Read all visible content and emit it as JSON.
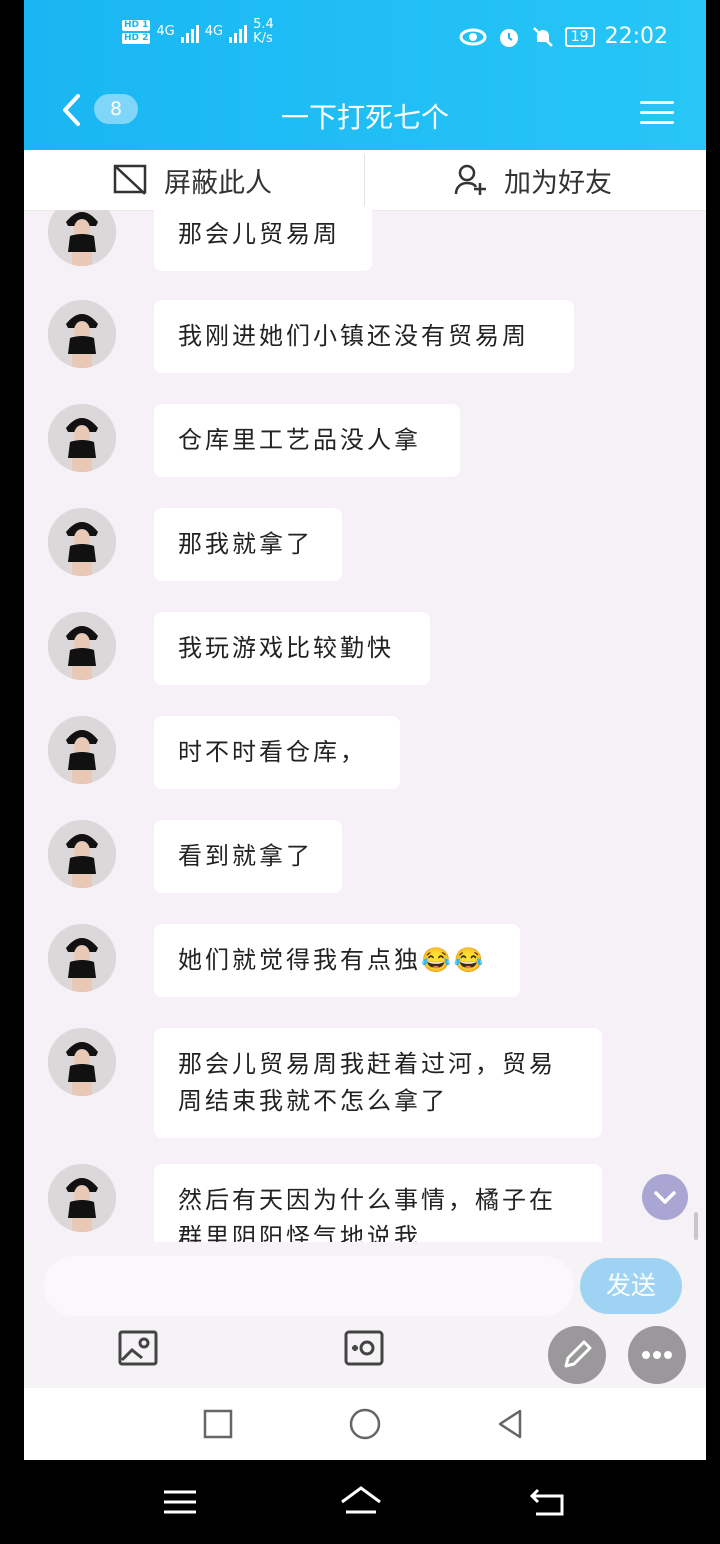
{
  "status_bar": {
    "hd1": "HD 1",
    "hd2": "HD 2",
    "sim1": "4G",
    "sim2": "4G",
    "net_speed": "5.4",
    "net_unit": "K/s",
    "battery": "19",
    "time": "22:02"
  },
  "header": {
    "unread_badge": "8",
    "title": "一下打死七个"
  },
  "actions": {
    "block_label": "屏蔽此人",
    "add_friend_label": "加为好友"
  },
  "messages": [
    {
      "text": "那会儿贸易周"
    },
    {
      "text": "我刚进她们小镇还没有贸易周"
    },
    {
      "text": "仓库里工艺品没人拿"
    },
    {
      "text": "那我就拿了"
    },
    {
      "text": "我玩游戏比较勤快"
    },
    {
      "text": "时不时看仓库，"
    },
    {
      "text": "看到就拿了"
    },
    {
      "text": "她们就觉得我有点独😂😂"
    },
    {
      "text": "那会儿贸易周我赶着过河，贸易周结束我就不怎么拿了"
    },
    {
      "text": "然后有天因为什么事情，橘子在群里阴阳怪气地说我"
    }
  ],
  "composer": {
    "input_value": "",
    "send_label": "发送"
  },
  "icons": {
    "back": "chevron-left-icon",
    "menu": "hamburger-icon",
    "block": "block-icon",
    "add_friend": "add-person-icon",
    "gallery": "image-icon",
    "camera": "camera-icon",
    "pen": "pen-icon",
    "more": "more-icon",
    "scroll_down": "chevron-down-icon"
  },
  "colors": {
    "header": "#1fbdf4",
    "send": "#9fd3f4",
    "chat_bg": "#f6f1f6"
  }
}
